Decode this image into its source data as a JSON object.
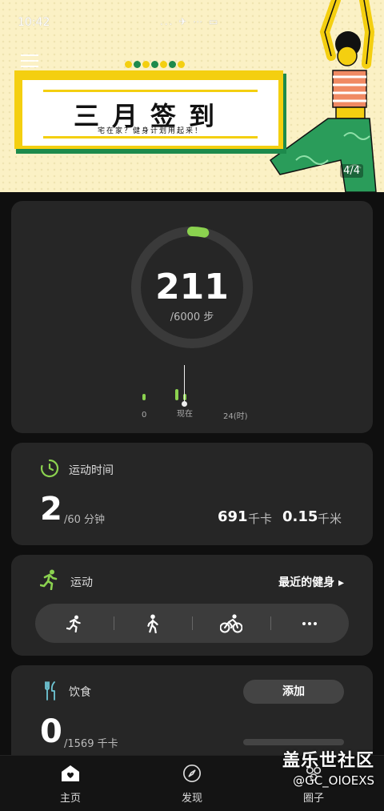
{
  "status_bar": {
    "time": "10:42",
    "icons": "... ✈ ⋯ ▭"
  },
  "banner": {
    "title": "三月签到",
    "subtitle": "宅在家？健身计划用起来！",
    "page_indicator": "4/4",
    "colors": {
      "background": "#fbf1c5",
      "yellow": "#f4cf10",
      "green": "#1d8a4c"
    }
  },
  "steps": {
    "value": "211",
    "goal": "/6000 步",
    "progress_fraction": 0.035,
    "timeline": {
      "start": "0",
      "now": "现在",
      "end": "24(时)"
    }
  },
  "exercise_time": {
    "label": "运动时间",
    "value": "2",
    "goal": "/60 分钟",
    "kcal_value": "691",
    "kcal_unit": "千卡",
    "km_value": "0.15",
    "km_unit": "千米"
  },
  "exercise": {
    "label": "运动",
    "recent_link": "最近的健身 ▸",
    "activities": [
      "run-icon",
      "walk-icon",
      "cycle-icon",
      "more-icon"
    ]
  },
  "food": {
    "label": "饮食",
    "add_label": "添加",
    "value": "0",
    "goal": "/1569 千卡"
  },
  "nav": {
    "home": "主页",
    "discover": "发现",
    "circle": "圈子"
  },
  "watermark": {
    "line1": "盖乐世社区",
    "line2": "@GC_OIOEXS"
  },
  "accent_color": "#8bd24f"
}
